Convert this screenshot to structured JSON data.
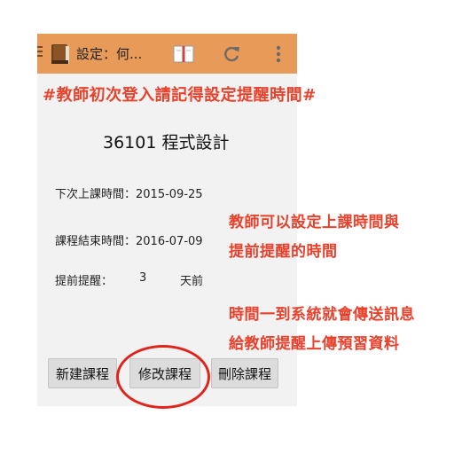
{
  "action_bar": {
    "title": "設定：何...",
    "color": "#e89a58"
  },
  "annotations": {
    "top": "#教師初次登入請記得設定提醒時間#",
    "side_line1": "教師可以設定上課時間與",
    "side_line2": "提前提醒的時間",
    "side_line3": "時間一到系統就會傳送訊息",
    "side_line4": "給教師提醒上傳預習資料",
    "color": "#e8412c"
  },
  "course": {
    "title": "36101  程式設計",
    "next_class": "下次上課時間：2015-09-25",
    "end_date": "課程結束時間：2016-07-09",
    "remind_label": "提前提醒：",
    "remind_value": "3",
    "remind_unit": "天前"
  },
  "buttons": {
    "new": "新建課程",
    "edit": "修改課程",
    "delete": "刪除課程"
  },
  "icons": [
    "app-book-icon",
    "book-icon",
    "refresh-icon",
    "overflow-menu-icon"
  ]
}
